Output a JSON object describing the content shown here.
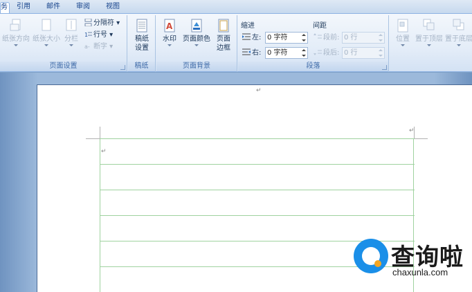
{
  "tabs": [
    {
      "label": "务",
      "active": true
    },
    {
      "label": "引用",
      "active": false
    },
    {
      "label": "邮件",
      "active": false
    },
    {
      "label": "审阅",
      "active": false
    },
    {
      "label": "视图",
      "active": false
    }
  ],
  "page_setup": {
    "label": "页面设置",
    "orientation": "纸张方向",
    "size": "纸张大小",
    "columns": "分栏",
    "breaks": "分隔符",
    "line_numbers": "行号",
    "hyphenation": "断字"
  },
  "draft_paper": {
    "label": "稿纸",
    "button": "稿纸设置"
  },
  "page_background": {
    "label": "页面背景",
    "watermark": "水印",
    "page_color": "页面颜色",
    "page_borders": "页面边框"
  },
  "paragraph": {
    "label": "段落",
    "indent_title": "缩进",
    "indent_left_label": "左:",
    "indent_left_value": "0 字符",
    "indent_right_label": "右:",
    "indent_right_value": "0 字符",
    "spacing_title": "间距",
    "spacing_before_label": "段前:",
    "spacing_before_value": "0 行",
    "spacing_after_label": "段后:",
    "spacing_after_value": "0 行"
  },
  "arrange": {
    "position": "位置",
    "bring_front": "置于顶层",
    "send_back": "置于底层"
  },
  "document": {
    "paragraph_mark": "↵",
    "grid_lines": 6
  },
  "watermark": {
    "brand": "查询啦",
    "url": "chaxunla.com",
    "brand_color": "#1a8fe8",
    "accent_color": "#f5a623"
  }
}
